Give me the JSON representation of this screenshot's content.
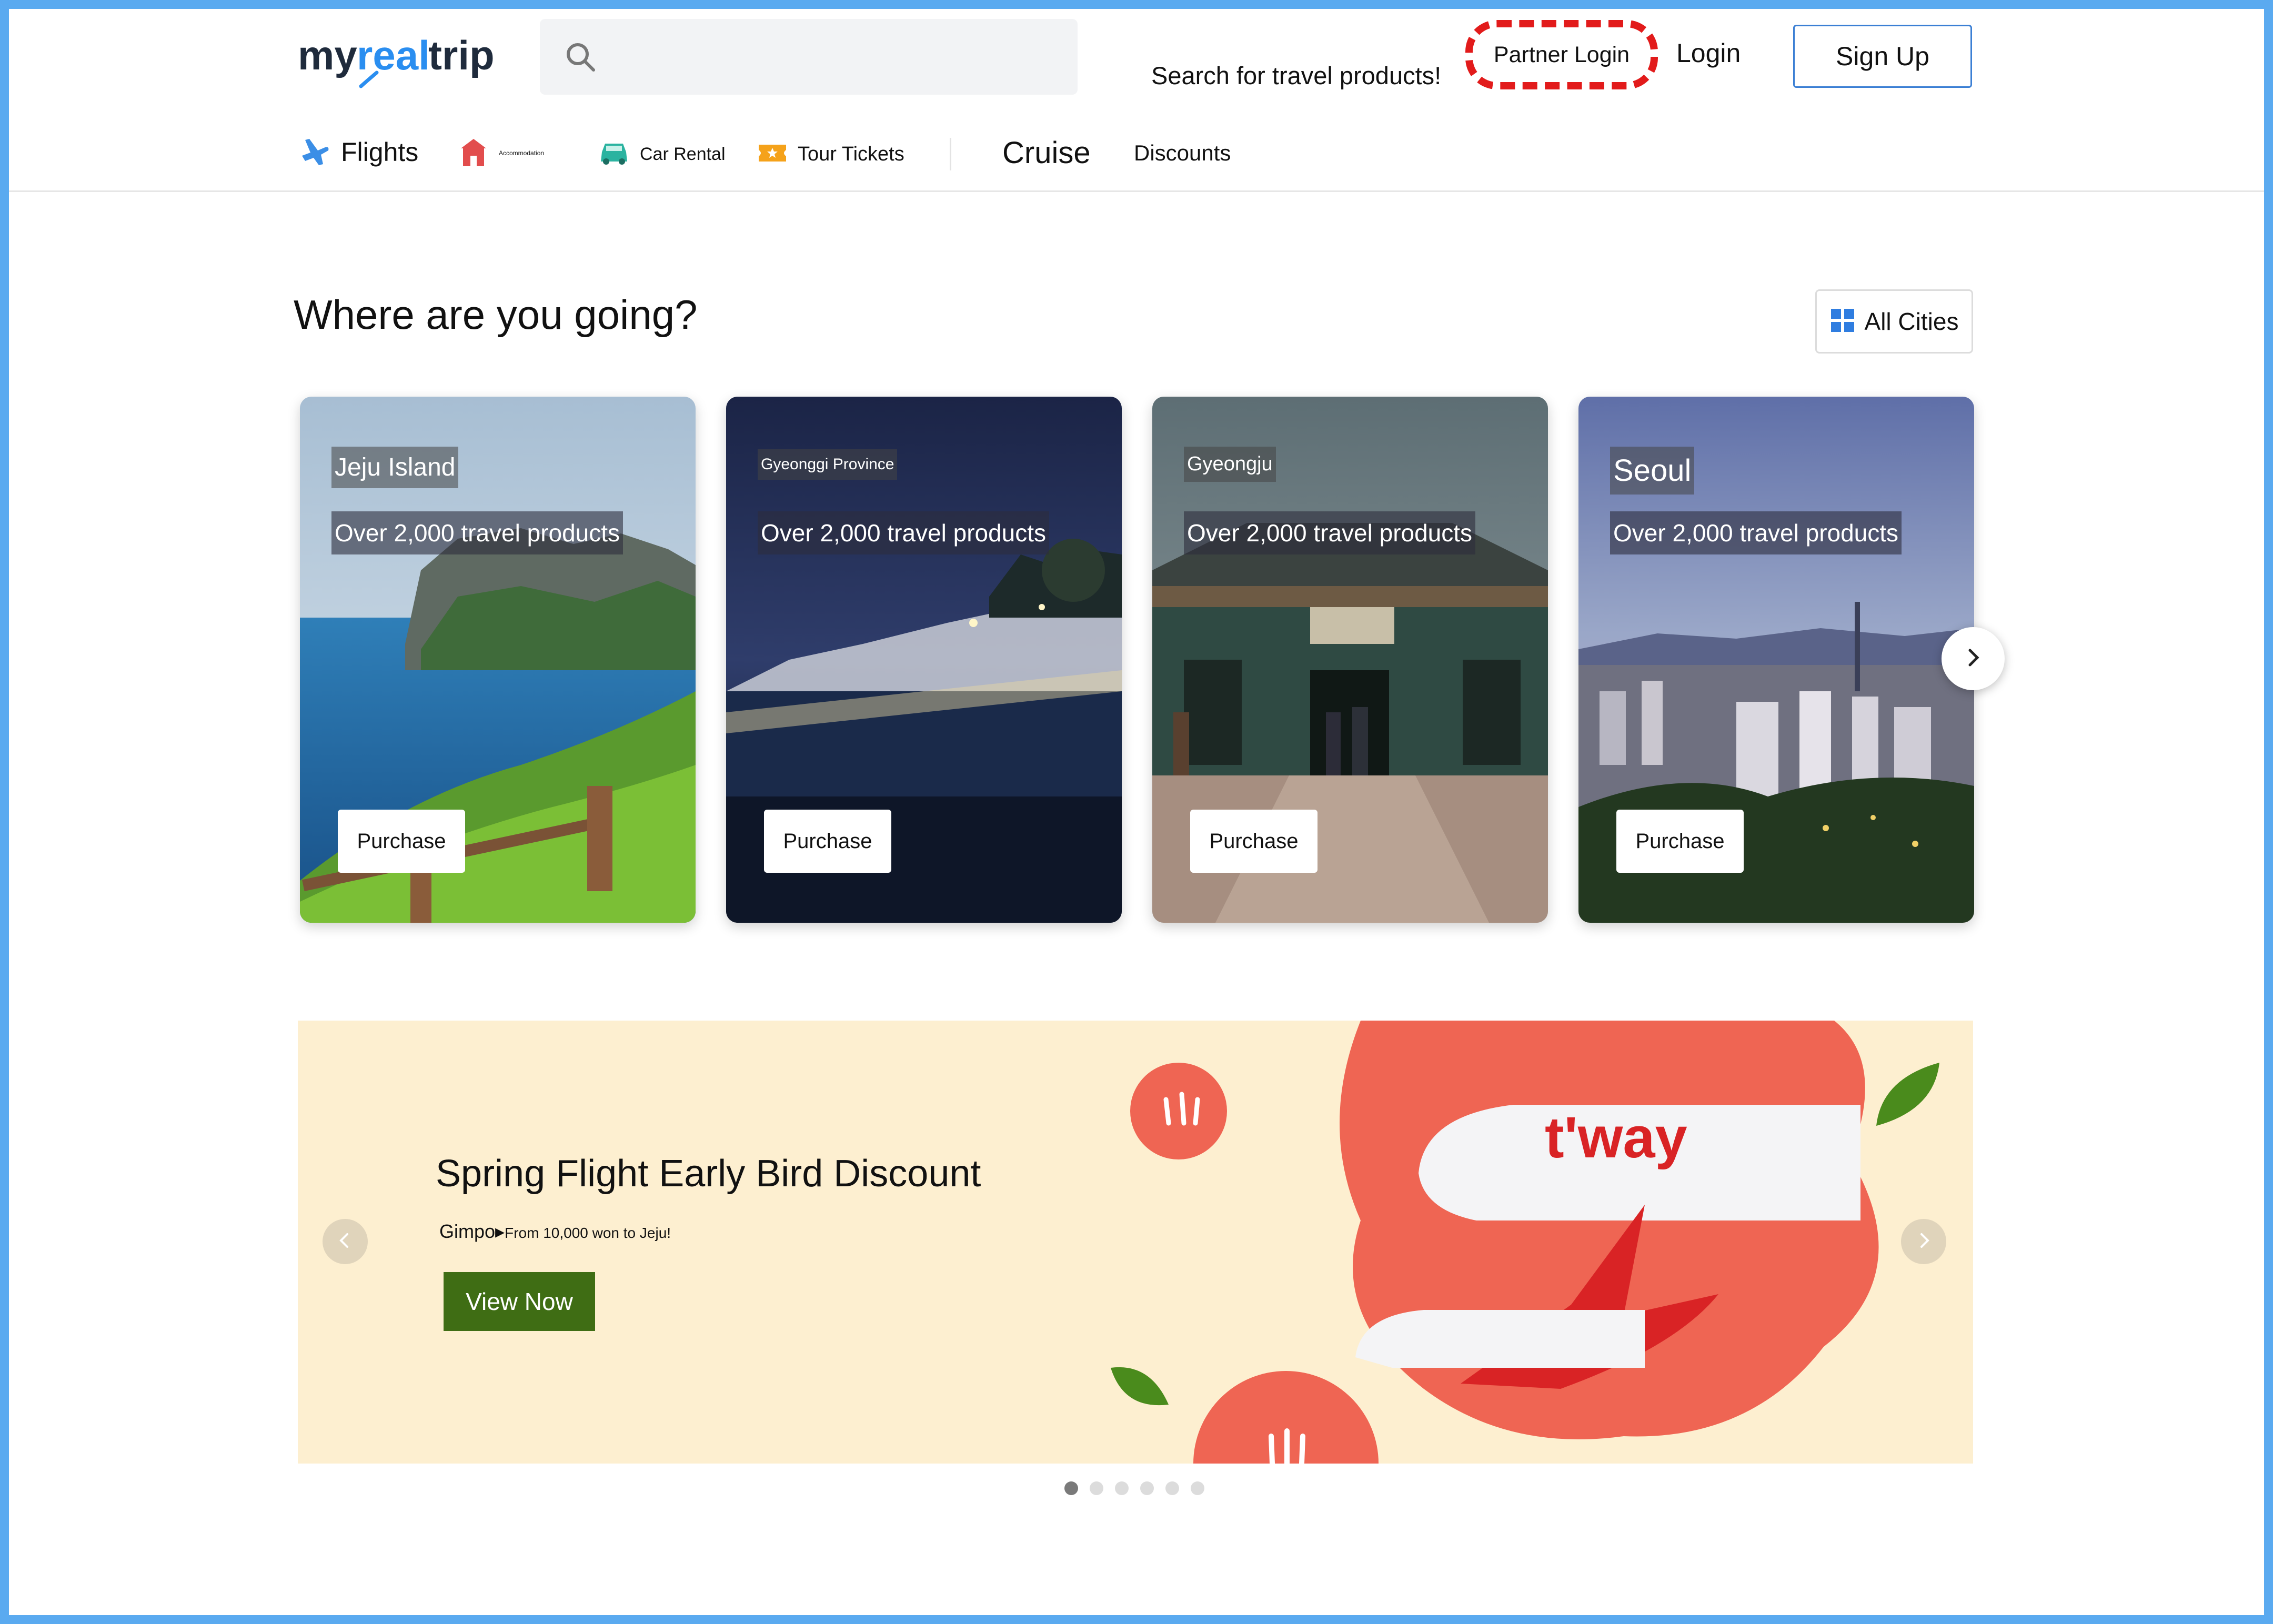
{
  "header": {
    "logo": {
      "part1": "my",
      "part2": "real",
      "part3": "trip"
    },
    "search": {
      "placeholder": "Search for travel products!"
    },
    "partner_login": "Partner Login",
    "login": "Login",
    "sign_up": "Sign Up"
  },
  "nav": {
    "flights": "Flights",
    "accommodation": "Accommodation",
    "car_rental": "Car Rental",
    "tour_tickets": "Tour Tickets",
    "cruise": "Cruise",
    "discounts": "Discounts"
  },
  "destinations": {
    "title": "Where are you going?",
    "all_cities": "All Cities",
    "cards": [
      {
        "name": "Jeju Island",
        "count": "Over 2,000 travel products",
        "button": "Purchase"
      },
      {
        "name": "Gyeonggi Province",
        "count": "Over 2,000 travel products",
        "button": "Purchase"
      },
      {
        "name": "Gyeongju",
        "count": "Over 2,000 travel products",
        "button": "Purchase"
      },
      {
        "name": "Seoul",
        "count": "Over 2,000 travel products",
        "button": "Purchase"
      }
    ]
  },
  "banner": {
    "title": "Spring Flight Early Bird Discount",
    "origin": "Gimpo",
    "route": "From 10,000 won to Jeju!",
    "button": "View Now",
    "airline_logo": "t'way",
    "slide_count": 6,
    "active_slide": 1
  },
  "colors": {
    "frame": "#5aaaf0",
    "accent_blue": "#3b7fd4",
    "partner_highlight": "#e21b1b",
    "banner_bg": "#fdefd0",
    "banner_button": "#3f6d14",
    "banner_red": "#ef6553"
  },
  "icons": {
    "search": "search-icon",
    "flights": "airplane-icon",
    "accommodation": "house-icon",
    "car_rental": "car-icon",
    "tour_tickets": "ticket-icon",
    "all_cities": "grid-icon",
    "next": "chevron-right-icon",
    "prev": "chevron-left-icon"
  }
}
